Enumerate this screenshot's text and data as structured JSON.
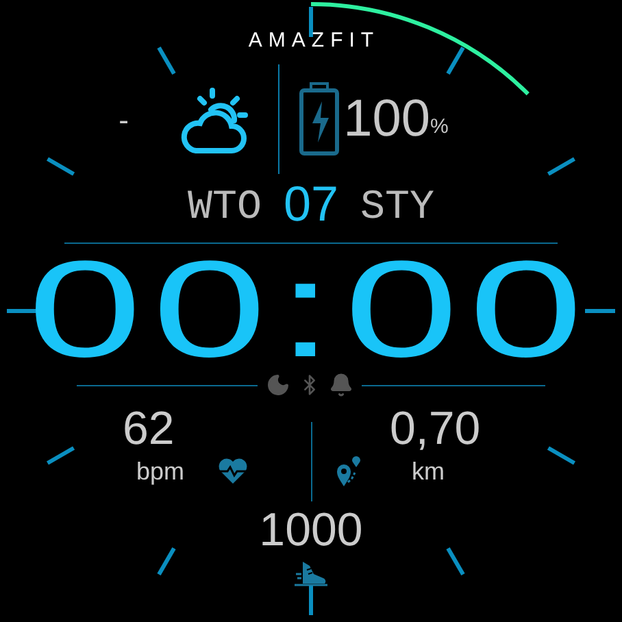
{
  "brand": "AMAZFIT",
  "weather": {
    "temperature": "-"
  },
  "battery": {
    "value": "100",
    "unit": "%"
  },
  "date": {
    "weekday": "WTO",
    "day": "07",
    "month": "STY"
  },
  "time": "00:00",
  "heart_rate": {
    "value": "62",
    "unit": "bpm"
  },
  "distance": {
    "value": "0,70",
    "unit": "km"
  },
  "steps": {
    "value": "1000"
  }
}
